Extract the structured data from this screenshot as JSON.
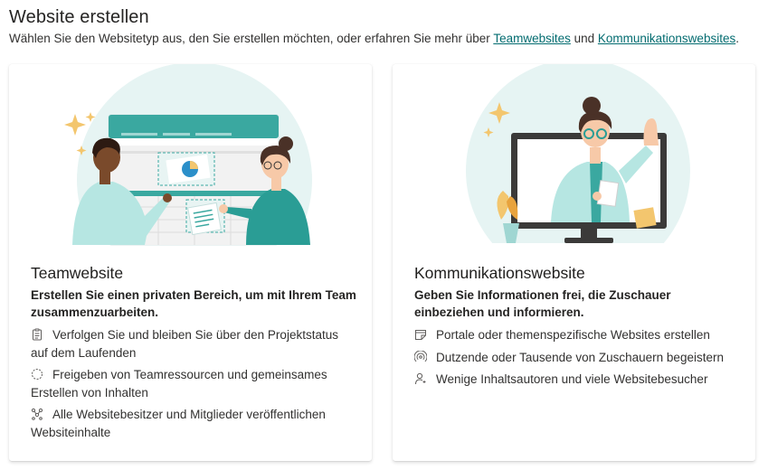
{
  "header": {
    "title": "Website erstellen",
    "subtitle_prefix": "Wählen Sie den Websitetyp aus, den Sie erstellen möchten, oder erfahren Sie mehr über ",
    "link_team": "Teamwebsites",
    "subtitle_and": " und ",
    "link_comm": "Kommunikationswebsites",
    "subtitle_suffix": "."
  },
  "cards": [
    {
      "title": "Teamwebsite",
      "description": "Erstellen Sie einen privaten Bereich, um mit Ihrem Team zusammenzuarbeiten.",
      "features": [
        {
          "icon": "clipboard-icon",
          "text": "Verfolgen Sie und bleiben Sie über den Projektstatus auf dem Laufenden"
        },
        {
          "icon": "sync-icon",
          "text": "Freigeben von Teamressourcen und gemeinsames Erstellen von Inhalten"
        },
        {
          "icon": "people-network-icon",
          "text": "Alle Websitebesitzer und Mitglieder veröffentlichen Websiteinhalte"
        }
      ]
    },
    {
      "title": "Kommunikationswebsite",
      "description": "Geben Sie Informationen frei, die Zuschauer einbeziehen und informieren.",
      "features": [
        {
          "icon": "page-edit-icon",
          "text": "Portale oder themenspezifische Websites erstellen"
        },
        {
          "icon": "broadcast-icon",
          "text": "Dutzende oder Tausende von Zuschauern begeistern"
        },
        {
          "icon": "person-icon",
          "text": "Wenige Inhaltsautoren und viele Websitebesucher"
        }
      ]
    }
  ],
  "colors": {
    "teal": "#3aa8a0",
    "link": "#036c70",
    "skin_light": "#f7c9a8",
    "skin_dark": "#7a4a2b",
    "hair": "#4a3127",
    "accent_yellow": "#f3c66e"
  }
}
